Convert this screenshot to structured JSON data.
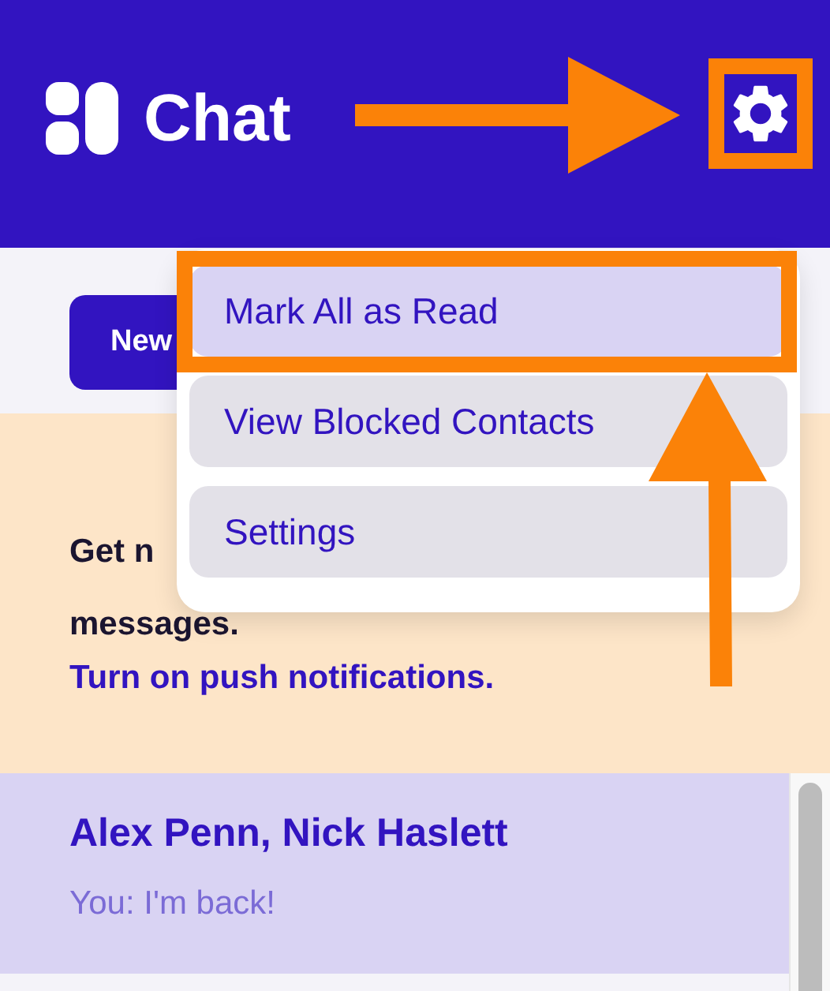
{
  "header": {
    "title": "Chat"
  },
  "toolbar": {
    "new_button": "New"
  },
  "banner": {
    "lines": [
      "Get n",
      "messages."
    ],
    "link": "Turn on push notifications."
  },
  "menu": {
    "items": [
      {
        "label": "Mark All as Read",
        "selected": true
      },
      {
        "label": "View Blocked Contacts",
        "selected": false
      },
      {
        "label": "Settings",
        "selected": false
      }
    ]
  },
  "conversations": [
    {
      "title": "Alex Penn, Nick Haslett",
      "preview": "You: I'm back!",
      "selected": true
    }
  ]
}
